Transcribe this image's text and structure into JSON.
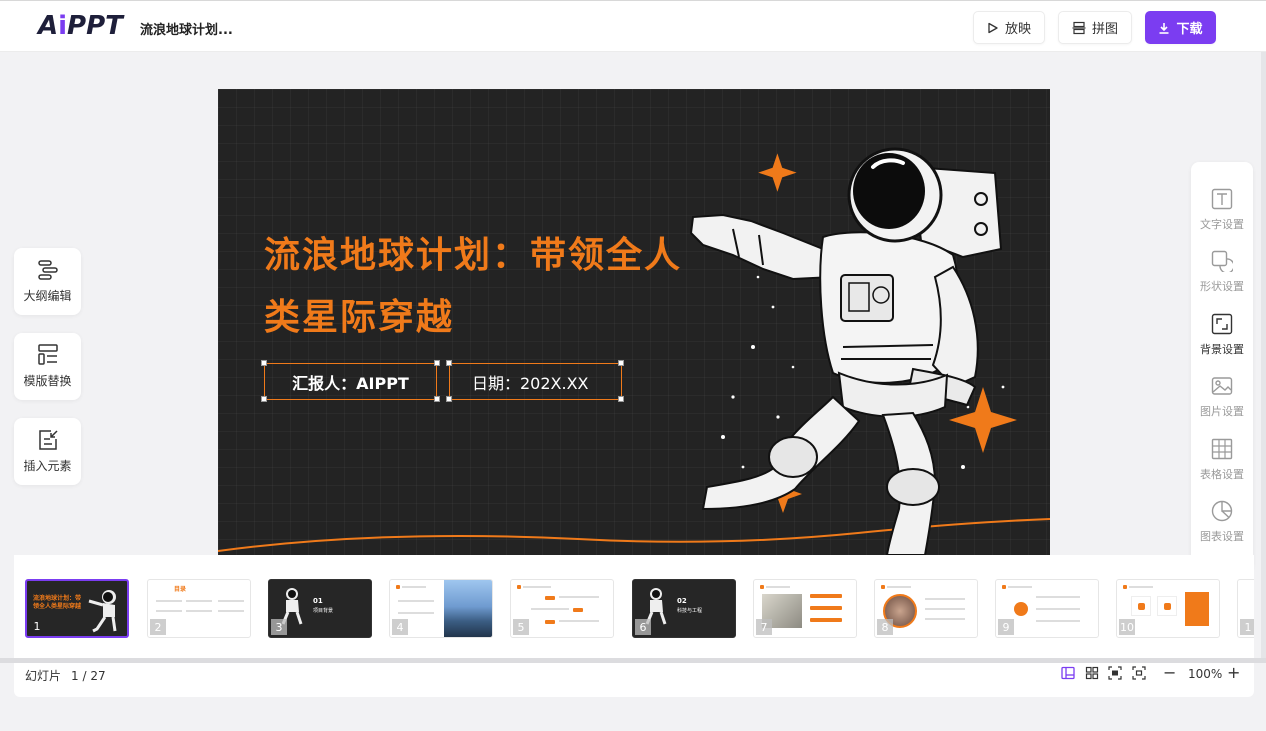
{
  "header": {
    "logo_main": "A",
    "logo_i": "i",
    "logo_tail": "PPT",
    "doc_title": "流浪地球计划...",
    "play_label": "放映",
    "collage_label": "拼图",
    "download_label": "下载"
  },
  "slide": {
    "title": "流浪地球计划：带领全人类星际穿越",
    "reporter": "汇报人：AIPPT",
    "date": "日期：202X.XX"
  },
  "left_tools": {
    "outline": "大纲编辑",
    "template": "模版替换",
    "insert": "插入元素"
  },
  "right_panel": {
    "text": "文字设置",
    "shape": "形状设置",
    "background": "背景设置",
    "image": "图片设置",
    "table": "表格设置",
    "chart": "图表设置"
  },
  "thumbnails": [
    {
      "num": "1",
      "title": "流浪地球计划：带领全人类星际穿越"
    },
    {
      "num": "2",
      "title": "目录"
    },
    {
      "num": "3",
      "code": "01",
      "subtitle": "项目背景"
    },
    {
      "num": "4"
    },
    {
      "num": "5"
    },
    {
      "num": "6",
      "code": "02",
      "subtitle": "科技与工程"
    },
    {
      "num": "7"
    },
    {
      "num": "8"
    },
    {
      "num": "9"
    },
    {
      "num": "10"
    },
    {
      "num": "1"
    }
  ],
  "status": {
    "label": "幻灯片",
    "page": "1 / 27",
    "zoom": "100%",
    "minus": "−",
    "plus": "+"
  },
  "colors": {
    "accent": "#7b3df1",
    "orange": "#f07a1a",
    "slide_bg": "#232323"
  }
}
